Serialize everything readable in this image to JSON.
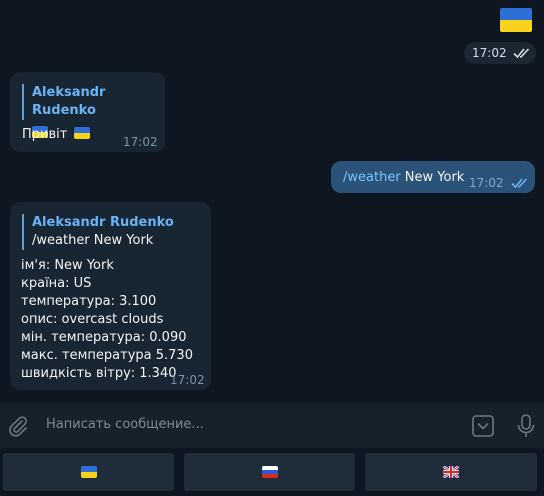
{
  "colors": {
    "background": "#0e1621",
    "incoming_bubble": "#182533",
    "outgoing_bubble": "#2b5278",
    "accent_name": "#6ab3f3",
    "command": "#7bc4ff"
  },
  "header_sticker": {
    "emoji": "ukraine-flag",
    "time": "17:02"
  },
  "messages": [
    {
      "reply_to": {
        "name": "Aleksandr Rudenko",
        "emoji": "ukraine-flag"
      },
      "text": "Привіт",
      "emoji": "ukraine-flag",
      "time": "17:02"
    },
    {
      "outgoing": true,
      "command": "/weather",
      "text": " New York",
      "time": "17:02"
    },
    {
      "reply_to": {
        "name": "Aleksandr Rudenko",
        "text": "/weather New York"
      },
      "lines": [
        "ім'я: New York",
        "країна: US",
        "температура: 3.100",
        "опис: overcast clouds",
        "мін. температура: 0.090",
        "макс. температура 5.730",
        "швидкість вітру: 1.340"
      ],
      "time": "17:02"
    }
  ],
  "input": {
    "placeholder": "Написать сообщение..."
  },
  "keyboard": [
    {
      "icon": "ukraine-flag"
    },
    {
      "icon": "russia-flag"
    },
    {
      "icon": "uk-flag"
    }
  ]
}
